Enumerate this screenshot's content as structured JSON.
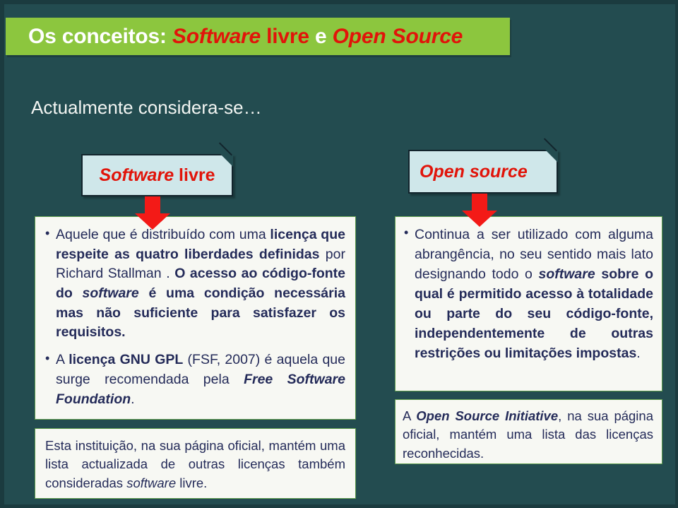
{
  "slide": {
    "background_color": "#234c50",
    "accent_green": "#8cc63e",
    "accent_red": "#e1140a",
    "box_background": "#f7f8f3",
    "callout_background": "#cfe7ea",
    "text_color": "#242b59"
  },
  "title": {
    "prefix": "Os conceitos: ",
    "term1": "Software",
    "middle1": " livre ",
    "conjunction": "e",
    "middle2": " ",
    "term2": "Open Source"
  },
  "subtitle": {
    "text": "Actualmente considera-se…"
  },
  "callouts": {
    "left": {
      "term": "Software",
      "rest": " livre",
      "icon": "folded-corner-icon",
      "arrow": "down-arrow-icon"
    },
    "right": {
      "label": "Open source",
      "icon": "folded-corner-icon",
      "arrow": "down-arrow-icon"
    }
  },
  "left_column": {
    "main_box": {
      "bullet1": {
        "t1": "Aquele que é distribuído com uma ",
        "b1": "licença que respeite as quatro liberdades definidas",
        "t2": " por Richard Stallman . ",
        "b2": "O acesso ao código-fonte do ",
        "bi1": "software",
        "b3": " é uma condição necessária mas não suficiente para satisfazer os requisitos."
      },
      "bullet2": {
        "t1": "A ",
        "b1": "licença GNU GPL",
        "t2": " (FSF, 2007) é aquela que surge recomendada pela ",
        "bi1": "Free Software Foundation",
        "t3": "."
      }
    },
    "second_box": {
      "t1": "Esta instituição, na sua página oficial, mantém uma lista actualizada de outras licenças também consideradas ",
      "i1": "software",
      "t2": " livre."
    }
  },
  "right_column": {
    "main_box": {
      "bullet1": {
        "t1": "Continua a ser utilizado com alguma abrangência, no seu sentido mais lato designando todo o ",
        "bi1": "software",
        "b1": " sobre o qual é permitido acesso à totalidade ou parte do seu código-fonte, independentemente de outras restrições ou limitações impostas",
        "t2": "."
      }
    },
    "second_box": {
      "t1": "A ",
      "bi1": "Open Source Initiative",
      "t2": ", na sua página oficial, mantém uma lista das licenças reconhecidas."
    }
  }
}
